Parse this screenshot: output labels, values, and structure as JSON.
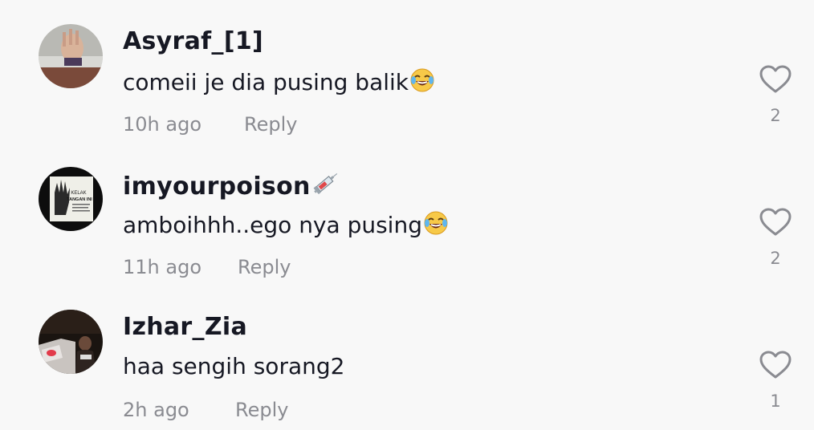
{
  "comments": [
    {
      "username": "Asyraf_[1]",
      "text": "comeii je dia pusing balik",
      "emoji": "laughing-tears-icon",
      "time": "10h ago",
      "reply_label": "Reply",
      "likes": "2"
    },
    {
      "username": "imyourpoison",
      "username_emoji": "syringe-icon",
      "text": "amboihhh..ego nya pusing",
      "emoji": "laughing-tears-icon",
      "time": "11h ago",
      "reply_label": "Reply",
      "likes": "2",
      "avatar_text": [
        "KELAK",
        "TANGAN INI"
      ]
    },
    {
      "username": "Izhar_Zia",
      "text": "haa sengih sorang2",
      "time": "2h ago",
      "reply_label": "Reply",
      "likes": "1"
    }
  ],
  "colors": {
    "background": "#f8f8f8",
    "primary_text": "#161823",
    "secondary_text": "#8a8b91"
  }
}
